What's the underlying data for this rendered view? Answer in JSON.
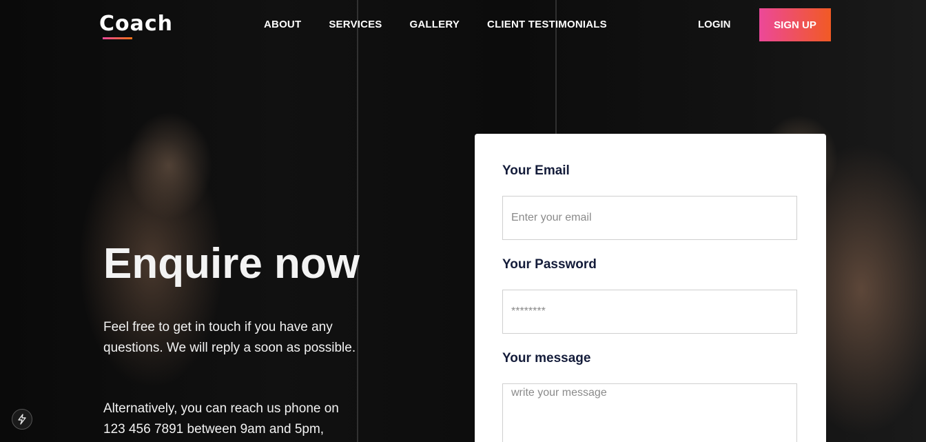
{
  "header": {
    "logo": "Coach",
    "nav": [
      "ABOUT",
      "SERVICES",
      "GALLERY",
      "CLIENT TESTIMONIALS"
    ],
    "login": "LOGIN",
    "signup": "SIGN UP"
  },
  "hero": {
    "title": "Enquire now",
    "paragraph1": "Feel free to get in touch if you have any questions. We will reply a soon as possible.",
    "paragraph2": "Alternatively, you can reach us phone on 123 456 7891 between 9am and 5pm,"
  },
  "form": {
    "email_label": "Your Email",
    "email_placeholder": "Enter your email",
    "password_label": "Your Password",
    "password_placeholder": "********",
    "message_label": "Your message",
    "message_placeholder": "write your message"
  },
  "colors": {
    "accent_start": "#ec4899",
    "accent_end": "#f15a24",
    "label_color": "#141c3a"
  },
  "icons": {
    "badge": "lightning-icon"
  }
}
